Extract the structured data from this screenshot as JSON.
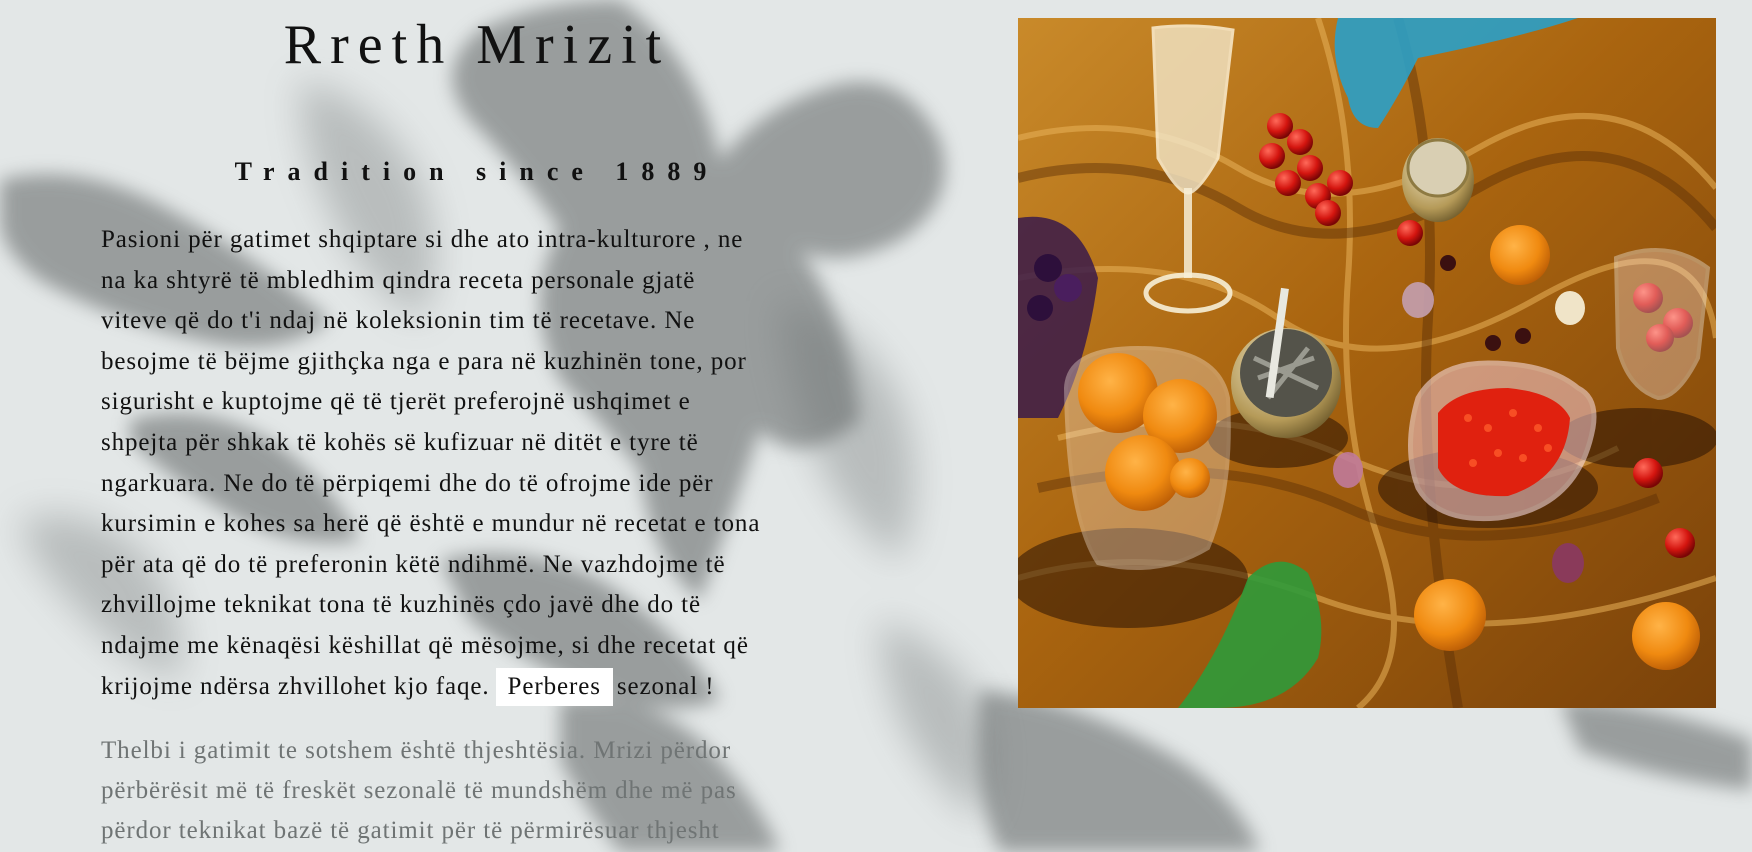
{
  "about": {
    "title": "Rreth Mrizit",
    "subtitle": "Tradition since 1889",
    "paragraph_lines": [
      "Pasioni për gatimet shqiptare si dhe ato intra-kulturore , ne",
      "na ka shtyrë të mbledhim qindra receta personale gjatë",
      "viteve që do t'i ndaj në koleksionin tim të recetave. Ne",
      "besojme të bëjme gjithçka nga e para në kuzhinën tone, por",
      "sigurisht e kuptojme që të tjerët preferojnë ushqimet e",
      "shpejta për shkak të kohës së kufizuar në ditët e tyre të",
      "ngarkuara. Ne do të përpiqemi dhe do të ofrojme ide për",
      "kursimin e kohes sa herë që është e mundur në recetat e tona",
      "për ata që do të preferonin këtë ndihmë. Ne vazhdojme të",
      "zhvillojme teknikat tona të kuzhinës çdo javë dhe do të",
      "ndajme me kënaqësi këshillat që mësojme, si dhe recetat që"
    ],
    "paragraph_last_line_before": "krijojme ndërsa zhvillohet kjo faqe.",
    "ingredients_button_label": "Perberes",
    "paragraph_last_line_after": "sezonal !",
    "essence_lines": [
      "Thelbi i gatimit te sotshem është thjeshtësia. Mrizi përdor",
      "përbërësit më të freskët sezonalë të mundshëm dhe më pas",
      "përdor teknikat bazë të gatimit për të përmirësuar thjesht"
    ]
  },
  "theme": {
    "background": "#e3e7e7",
    "text": "#111111",
    "faded_text": "#6f7474",
    "button_bg": "#ffffff",
    "photo_velvet": "#b7751a"
  },
  "icons": {
    "photo": "still-life-food-photo"
  }
}
